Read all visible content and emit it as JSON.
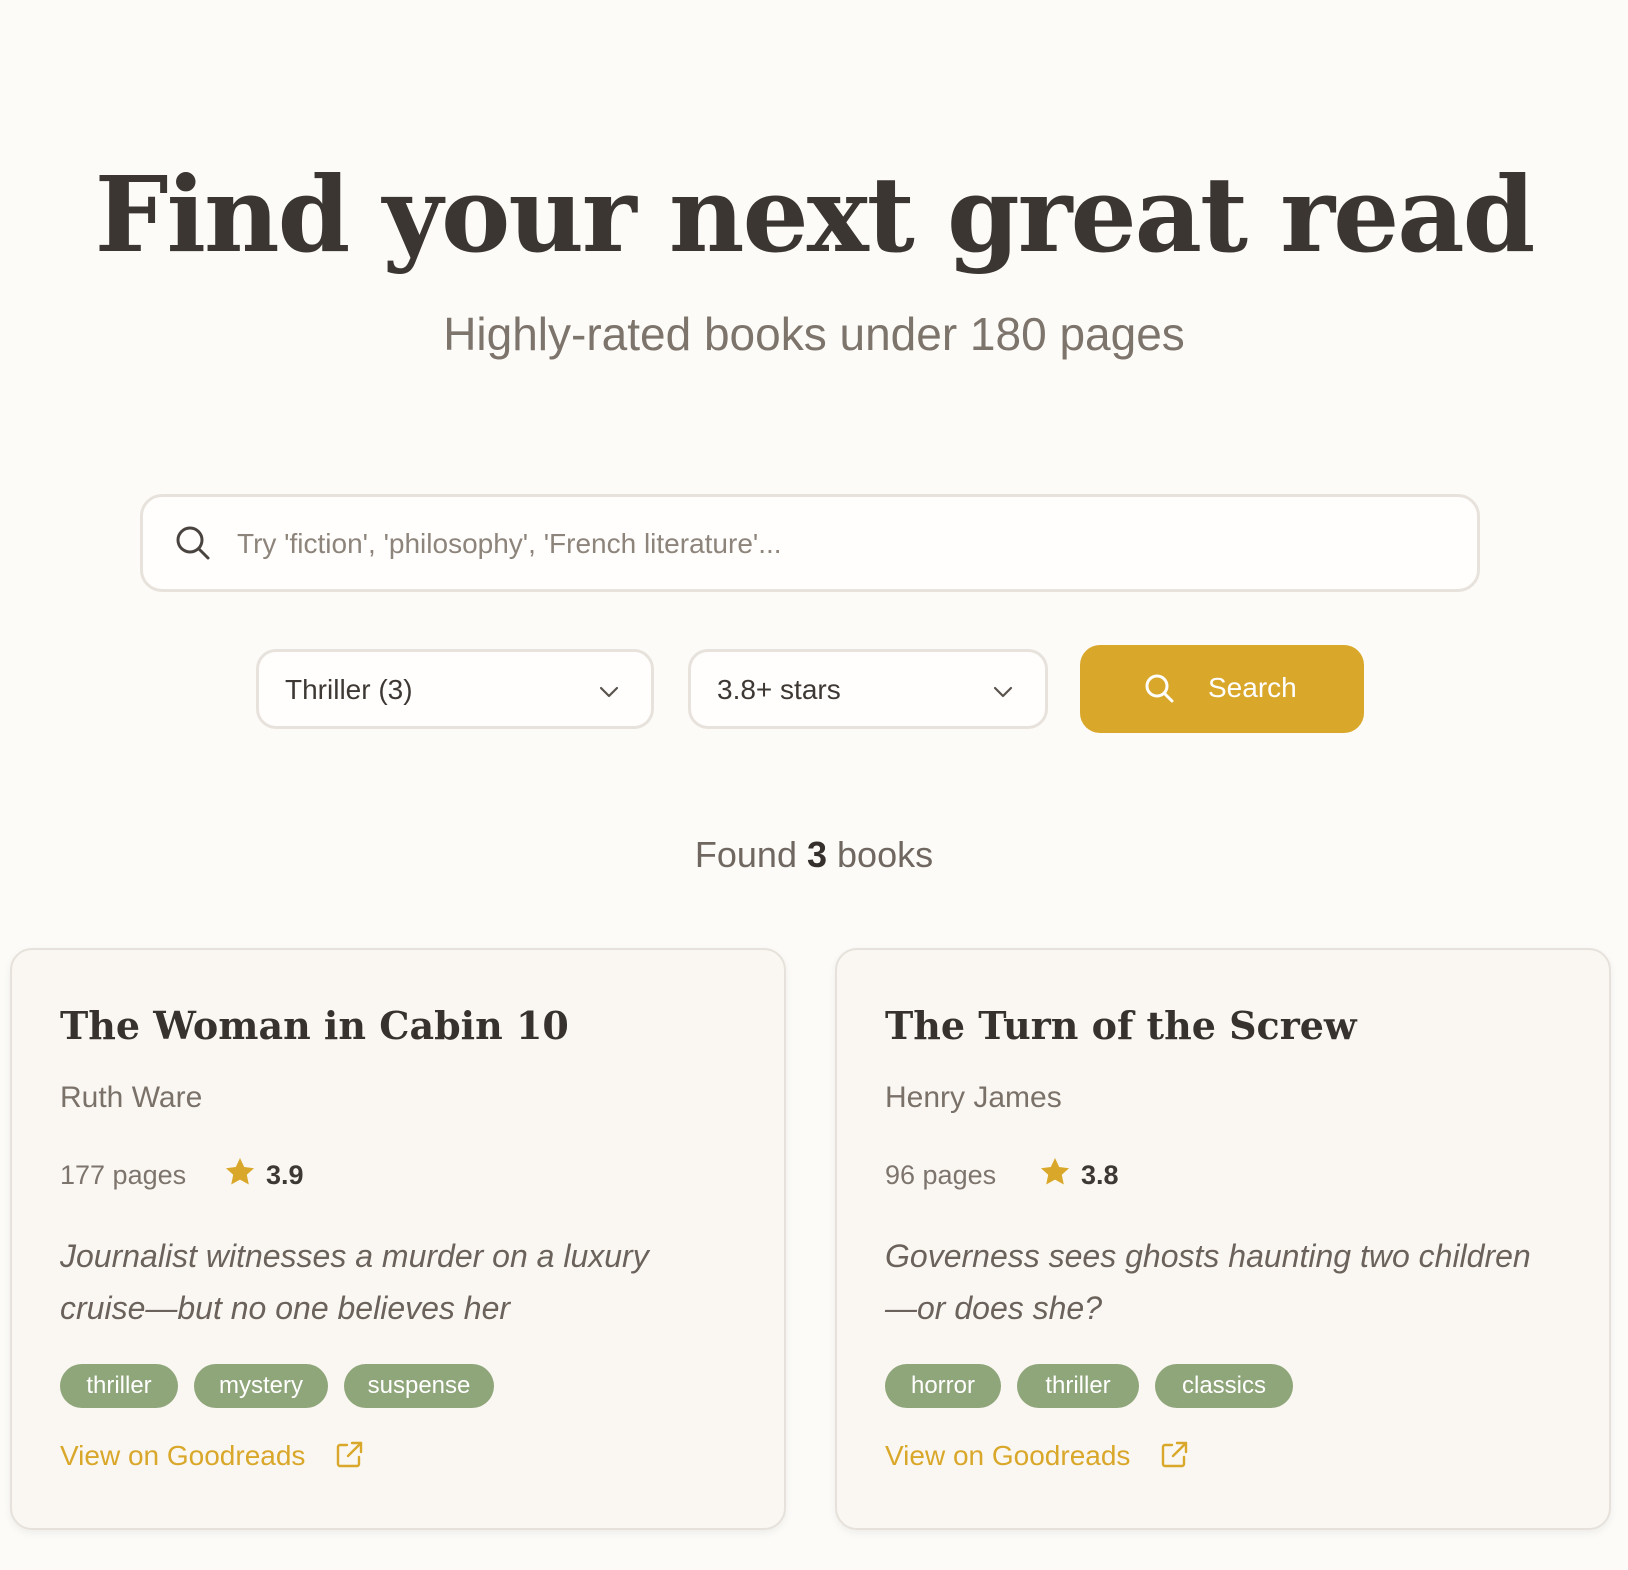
{
  "hero": {
    "title": "Find your next great read",
    "subtitle": "Highly-rated books under 180 pages"
  },
  "search": {
    "placeholder": "Try 'fiction', 'philosophy', 'French literature'...",
    "value": "",
    "icon": "search-icon"
  },
  "filters": {
    "genre": "Thriller (3)",
    "rating": "3.8+ stars",
    "search_button_label": "Search"
  },
  "results": {
    "prefix": "Found",
    "count": "3",
    "suffix": "books"
  },
  "books": [
    {
      "title": "The Woman in Cabin 10",
      "author": "Ruth Ware",
      "pages": "177 pages",
      "rating": "3.9",
      "description": "Journalist witnesses a murder on a luxury cruise—but no one believes her",
      "tags": [
        "thriller",
        "mystery",
        "suspense"
      ],
      "link_label": "View on Goodreads"
    },
    {
      "title": "The Turn of the Screw",
      "author": "Henry James",
      "pages": "96 pages",
      "rating": "3.8",
      "description": "Governess sees ghosts haunting two children —or does she?",
      "tags": [
        "horror",
        "thriller",
        "classics"
      ],
      "link_label": "View on Goodreads"
    }
  ],
  "colors": {
    "accent": "#d9a72a",
    "tag": "#8fa57a",
    "background": "#fcfbf8",
    "card": "#faf7f2"
  }
}
